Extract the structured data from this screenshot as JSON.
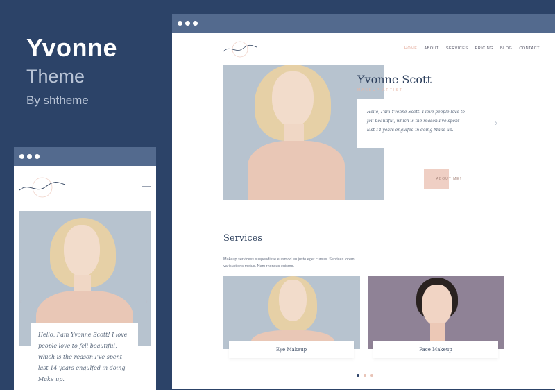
{
  "promo": {
    "title": "Yvonne",
    "subtitle": "Theme",
    "byline": "By shtheme"
  },
  "desktop": {
    "logo_text": "ys",
    "nav": [
      "HOME",
      "ABOUT",
      "SERVICES",
      "PRICING",
      "BLOG",
      "CONTACT"
    ],
    "active_nav": "HOME",
    "hero": {
      "name": "Yvonne Scott",
      "role": "MAKEUP ARTIST",
      "quote": "Hello, I'am Yvonne Scott! I love people love to fell beautiful, which is the reason I've spent last 14 years engulfed in doing Make up.",
      "button": "ABOUT ME!",
      "prev_arrow": "‹",
      "next_arrow": "›"
    },
    "services": {
      "title": "Services",
      "text": "Makeup servicess suspendisse euismod eu justo eget cursus. Services lorem varisustions metus. Nam rhoncus euismo.",
      "cards": [
        "Eye Makeup",
        "Face Makeup"
      ]
    }
  },
  "mobile": {
    "logo_text": "ys",
    "quote": "Hello, I'am Yvonne Scott! I love people love to fell beautiful, which is the reason I've spent last 14 years engulfed in doing Make up.",
    "prev_arrow": "‹",
    "next_arrow": "›"
  },
  "colors": {
    "background": "#2c4368",
    "titlebar": "#536a8e",
    "accent": "#e3a897",
    "photo_bg": "#b7c3cf"
  }
}
